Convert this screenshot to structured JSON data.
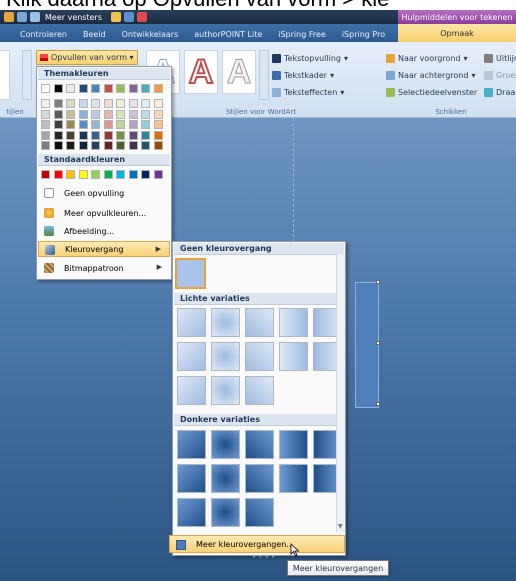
{
  "caption": {
    "text": "Klik daarna op Opvullen van vorm > kle"
  },
  "titlebar": {
    "meer_vensters": "Meer vensters",
    "hulp": "Hulpmiddelen voor tekenen"
  },
  "tabs": [
    "Controleren",
    "Beeld",
    "Ontwikkelaars",
    "authorPOINT Lite",
    "iSpring Free",
    "iSpring Pro"
  ],
  "opmaak_tab": "Opmaak",
  "ribbon": {
    "fill_button": "Opvullen van vorm",
    "tekstopvulling": "Tekstopvulling",
    "tekstkader": "Tekstkader",
    "teksteffecten": "Teksteffecten",
    "naar_voorgrond": "Naar voorgrond",
    "naar_achtergrond": "Naar achtergrond",
    "selectiedeelvenster": "Selectiedeelvenster",
    "uitlijnen": "Uitlijn",
    "groeperen": "Groep",
    "draaien": "Draai",
    "group_stijlen": "Stijlen voor WordArt",
    "group_schikken": "Schikken",
    "group_left": "tijlen",
    "wordart_letter": "A"
  },
  "menu": {
    "themakleuren": "Themakleuren",
    "standaardkleuren": "Standaardkleuren",
    "items": [
      {
        "label": "Geen opvulling",
        "icon": "no-fill-icon"
      },
      {
        "label": "Meer opvulkleuren...",
        "icon": "palette-icon"
      },
      {
        "label": "Afbeelding...",
        "icon": "picture-icon"
      },
      {
        "label": "Kleurovergang",
        "icon": "gradient-icon",
        "submenu": true
      },
      {
        "label": "Bitmappatroon",
        "icon": "texture-icon",
        "submenu": true
      }
    ],
    "theme_top": [
      "#ffffff",
      "#000000",
      "#eeece1",
      "#1f497d",
      "#4f81bd",
      "#c0504d",
      "#9bbb59",
      "#8064a2",
      "#4bacc6",
      "#f79646"
    ],
    "theme_cols": [
      [
        "#f2f2f2",
        "#d8d8d8",
        "#bfbfbf",
        "#a5a5a5",
        "#7f7f7f"
      ],
      [
        "#7f7f7f",
        "#595959",
        "#3f3f3f",
        "#262626",
        "#0c0c0c"
      ],
      [
        "#ddd9c3",
        "#c4bd97",
        "#938953",
        "#494429",
        "#1d1b10"
      ],
      [
        "#c6d9f0",
        "#8db3e2",
        "#548dd4",
        "#17365d",
        "#0f243e"
      ],
      [
        "#dbe5f1",
        "#b8cce4",
        "#95b3d7",
        "#366092",
        "#244061"
      ],
      [
        "#f2dcdb",
        "#e5b9b7",
        "#d99694",
        "#953734",
        "#632423"
      ],
      [
        "#ebf1dd",
        "#d7e3bc",
        "#c3d69b",
        "#76923c",
        "#4f6128"
      ],
      [
        "#e5e0ec",
        "#ccc1d9",
        "#b2a2c7",
        "#5f497a",
        "#3f3151"
      ],
      [
        "#dbeef3",
        "#b7dde8",
        "#92cddc",
        "#31859b",
        "#205867"
      ],
      [
        "#fdeada",
        "#fbd5b5",
        "#fac08f",
        "#e36c09",
        "#974806"
      ]
    ],
    "standard": [
      "#c00000",
      "#ff0000",
      "#ffc000",
      "#ffff00",
      "#92d050",
      "#00b050",
      "#00b0f0",
      "#0070c0",
      "#002060",
      "#7030a0"
    ]
  },
  "submenu": {
    "geen": "Geen kleurovergang",
    "lichte": "Lichte variaties",
    "donkere": "Donkere variaties",
    "more": "Meer kleurovergangen..."
  },
  "tooltip": "Meer kleurovergangen"
}
